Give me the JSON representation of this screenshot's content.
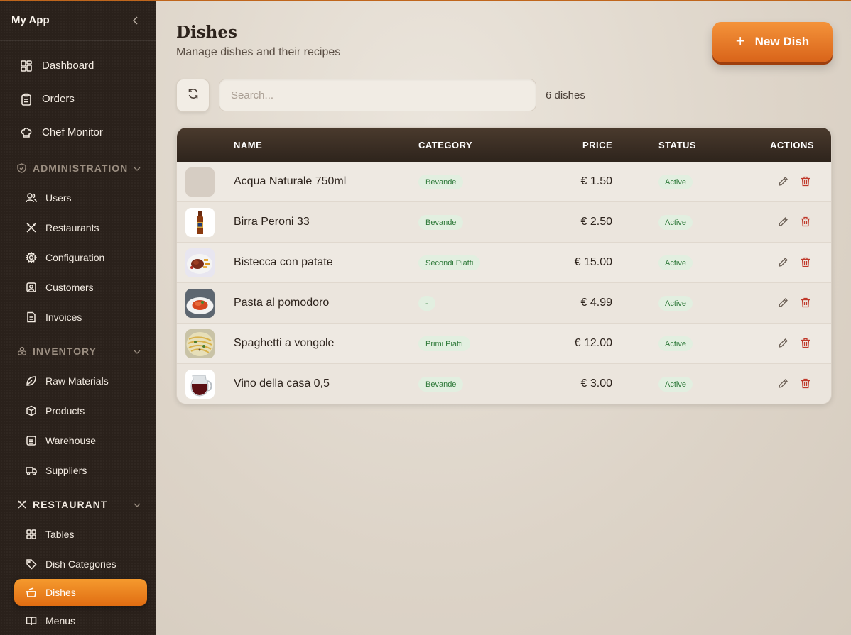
{
  "app": {
    "title": "My App"
  },
  "sidebar": {
    "top_items": [
      {
        "label": "Dashboard",
        "icon": "dashboard-icon"
      },
      {
        "label": "Orders",
        "icon": "clipboard-icon"
      },
      {
        "label": "Chef Monitor",
        "icon": "chef-hat-icon"
      }
    ],
    "sections": [
      {
        "label": "ADMINISTRATION",
        "icon": "shield-icon",
        "items": [
          {
            "label": "Users",
            "icon": "users-icon"
          },
          {
            "label": "Restaurants",
            "icon": "utensils-icon"
          },
          {
            "label": "Configuration",
            "icon": "gear-icon"
          },
          {
            "label": "Customers",
            "icon": "contact-icon"
          },
          {
            "label": "Invoices",
            "icon": "document-icon"
          }
        ]
      },
      {
        "label": "INVENTORY",
        "icon": "boxes-icon",
        "items": [
          {
            "label": "Raw Materials",
            "icon": "leaf-icon"
          },
          {
            "label": "Products",
            "icon": "package-icon"
          },
          {
            "label": "Warehouse",
            "icon": "warehouse-icon"
          },
          {
            "label": "Suppliers",
            "icon": "truck-icon"
          }
        ]
      },
      {
        "label": "RESTAURANT",
        "icon": "utensils-icon",
        "items": [
          {
            "label": "Tables",
            "icon": "grid-icon"
          },
          {
            "label": "Dish Categories",
            "icon": "tag-icon"
          },
          {
            "label": "Dishes",
            "icon": "cooking-pot-icon",
            "active": true
          },
          {
            "label": "Menus",
            "icon": "book-icon"
          }
        ]
      }
    ]
  },
  "page": {
    "title": "Dishes",
    "subtitle": "Manage dishes and their recipes",
    "new_button_label": "New Dish",
    "new_button_plus": "+",
    "search_placeholder": "Search...",
    "count_label": "6 dishes"
  },
  "table": {
    "headers": {
      "name": "NAME",
      "category": "CATEGORY",
      "price": "PRICE",
      "status": "STATUS",
      "actions": "ACTIONS"
    },
    "rows": [
      {
        "name": "Acqua Naturale 750ml",
        "category": "Bevande",
        "price": "€ 1.50",
        "status": "Active",
        "image": "placeholder"
      },
      {
        "name": "Birra Peroni 33",
        "category": "Bevande",
        "price": "€ 2.50",
        "status": "Active",
        "image": "beer-bottle-photo"
      },
      {
        "name": "Bistecca con patate",
        "category": "Secondi Piatti",
        "price": "€ 15.00",
        "status": "Active",
        "image": "steak-photo"
      },
      {
        "name": "Pasta al pomodoro",
        "category": "-",
        "price": "€ 4.99",
        "status": "Active",
        "image": "pasta-photo"
      },
      {
        "name": "Spaghetti a vongole",
        "category": "Primi Piatti",
        "price": "€ 12.00",
        "status": "Active",
        "image": "spaghetti-photo"
      },
      {
        "name": "Vino della casa 0,5",
        "category": "Bevande",
        "price": "€ 3.00",
        "status": "Active",
        "image": "wine-jug-photo"
      }
    ]
  },
  "colors": {
    "accent": "#e8771c",
    "sidebar_bg": "#2a211b",
    "badge_green": "#2f7a3a",
    "delete_red": "#c0392b"
  }
}
